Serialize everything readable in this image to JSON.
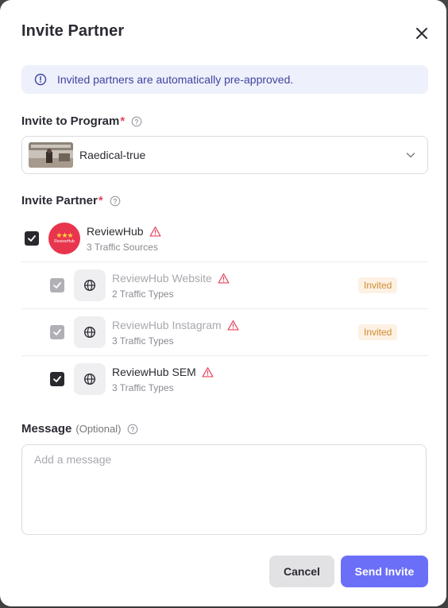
{
  "modal": {
    "title": "Invite Partner",
    "info_text": "Invited partners are automatically pre-approved."
  },
  "program": {
    "label": "Invite to Program",
    "required_mark": "*",
    "selected_value": "Raedical-true"
  },
  "partner_section": {
    "label": "Invite Partner",
    "required_mark": "*",
    "partner": {
      "name": "ReviewHub",
      "subtitle": "3 Traffic Sources",
      "checked": true,
      "avatar_stars": "★★★",
      "avatar_text": "ReviewHub"
    },
    "sources": [
      {
        "name": "ReviewHub Website",
        "subtitle": "2 Traffic Types",
        "badge": "Invited",
        "checked": true,
        "disabled": true
      },
      {
        "name": "ReviewHub Instagram",
        "subtitle": "3 Traffic Types",
        "badge": "Invited",
        "checked": true,
        "disabled": true
      },
      {
        "name": "ReviewHub SEM",
        "subtitle": "3 Traffic Types",
        "badge": "",
        "checked": true,
        "disabled": false
      }
    ]
  },
  "message": {
    "label": "Message",
    "optional": "(Optional)",
    "placeholder": "Add a message",
    "value": ""
  },
  "buttons": {
    "cancel": "Cancel",
    "send": "Send Invite"
  },
  "colors": {
    "accent": "#6b6ff7",
    "required": "#e5455e",
    "warning": "#e5455e",
    "badge_bg": "#fdf1e3",
    "badge_text": "#d08a32",
    "info_bg": "#eef0fb"
  },
  "icons": {
    "close": "close-icon",
    "info": "info-icon",
    "help": "help-circle-icon",
    "chevron": "chevron-down-icon",
    "warning": "warning-triangle-icon",
    "globe": "globe-icon",
    "check": "check-icon"
  }
}
